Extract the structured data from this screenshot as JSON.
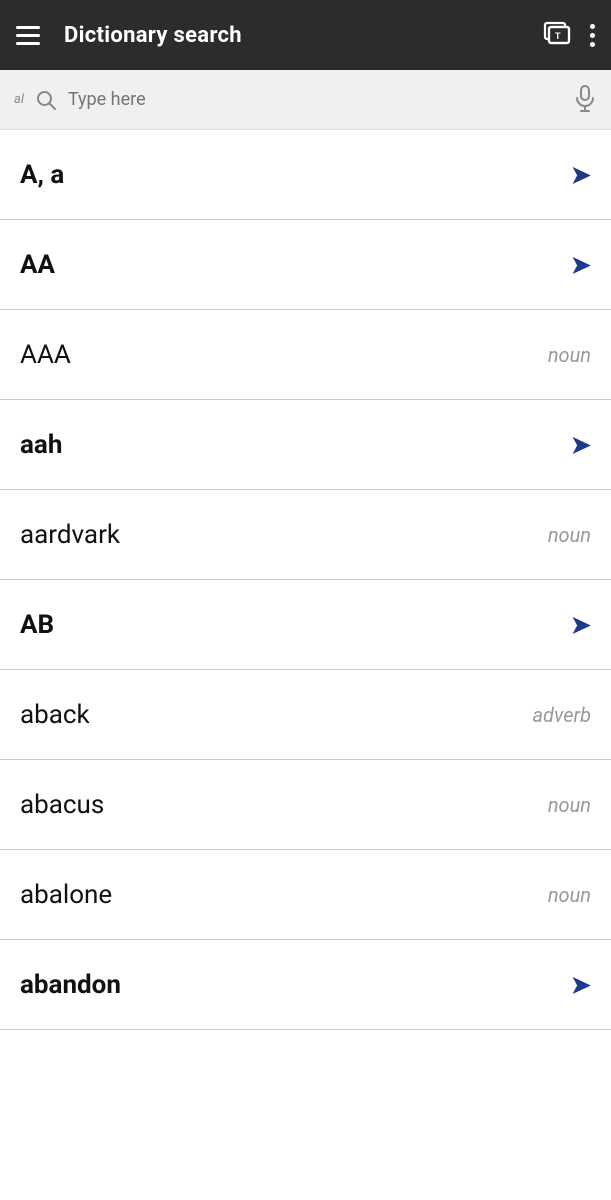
{
  "header": {
    "title": "Dictionary search",
    "menu_icon": "menu-icon",
    "flashcard_icon": "flashcard-icon",
    "more_icon": "more-options-icon"
  },
  "search": {
    "prefix": "al",
    "placeholder": "Type here",
    "mic_icon": "microphone-icon"
  },
  "entries": [
    {
      "id": 1,
      "word": "A, a",
      "tag": null,
      "has_chevron": true,
      "bold": true
    },
    {
      "id": 2,
      "word": "AA",
      "tag": null,
      "has_chevron": true,
      "bold": true
    },
    {
      "id": 3,
      "word": "AAA",
      "tag": "noun",
      "has_chevron": false,
      "bold": false
    },
    {
      "id": 4,
      "word": "aah",
      "tag": null,
      "has_chevron": true,
      "bold": true
    },
    {
      "id": 5,
      "word": "aardvark",
      "tag": "noun",
      "has_chevron": false,
      "bold": false
    },
    {
      "id": 6,
      "word": "AB",
      "tag": null,
      "has_chevron": true,
      "bold": true
    },
    {
      "id": 7,
      "word": "aback",
      "tag": "adverb",
      "has_chevron": false,
      "bold": false
    },
    {
      "id": 8,
      "word": "abacus",
      "tag": "noun",
      "has_chevron": false,
      "bold": false
    },
    {
      "id": 9,
      "word": "abalone",
      "tag": "noun",
      "has_chevron": false,
      "bold": false
    },
    {
      "id": 10,
      "word": "abandon",
      "tag": null,
      "has_chevron": true,
      "bold": true
    }
  ],
  "colors": {
    "header_bg": "#2c2c2c",
    "chevron_color": "#1a3a8a",
    "tag_color": "#999999",
    "divider_color": "#cccccc"
  }
}
